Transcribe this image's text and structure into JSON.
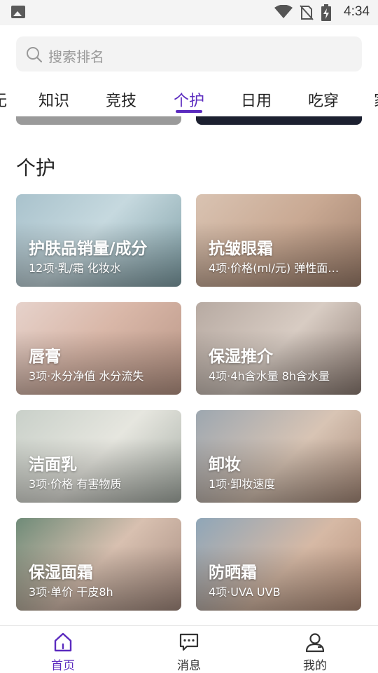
{
  "status_bar": {
    "time": "4:34"
  },
  "search": {
    "placeholder": "搜索排名"
  },
  "tabs": [
    {
      "label": "无"
    },
    {
      "label": "知识"
    },
    {
      "label": "竞技"
    },
    {
      "label": "个护"
    },
    {
      "label": "日用"
    },
    {
      "label": "吃穿"
    },
    {
      "label": "家"
    }
  ],
  "active_tab": "个护",
  "section": {
    "title": "个护"
  },
  "cards": [
    {
      "title": "护肤品销量/成分",
      "subtitle": "12项·乳/霜 化妆水"
    },
    {
      "title": "抗皱眼霜",
      "subtitle": "4项·价格(ml/元) 弹性面…"
    },
    {
      "title": "唇膏",
      "subtitle": "3项·水分净值 水分流失"
    },
    {
      "title": "保湿推介",
      "subtitle": "4项·4h含水量 8h含水量"
    },
    {
      "title": "洁面乳",
      "subtitle": "3项·价格 有害物质"
    },
    {
      "title": "卸妆",
      "subtitle": "1项·卸妆速度"
    },
    {
      "title": "保湿面霜",
      "subtitle": "3项·单价 干皮8h"
    },
    {
      "title": "防晒霜",
      "subtitle": "4项·UVA UVB"
    }
  ],
  "bottom_nav": [
    {
      "label": "首页",
      "icon": "home-icon"
    },
    {
      "label": "消息",
      "icon": "message-icon"
    },
    {
      "label": "我的",
      "icon": "profile-icon"
    }
  ],
  "colors": {
    "accent": "#5b2bbf"
  }
}
